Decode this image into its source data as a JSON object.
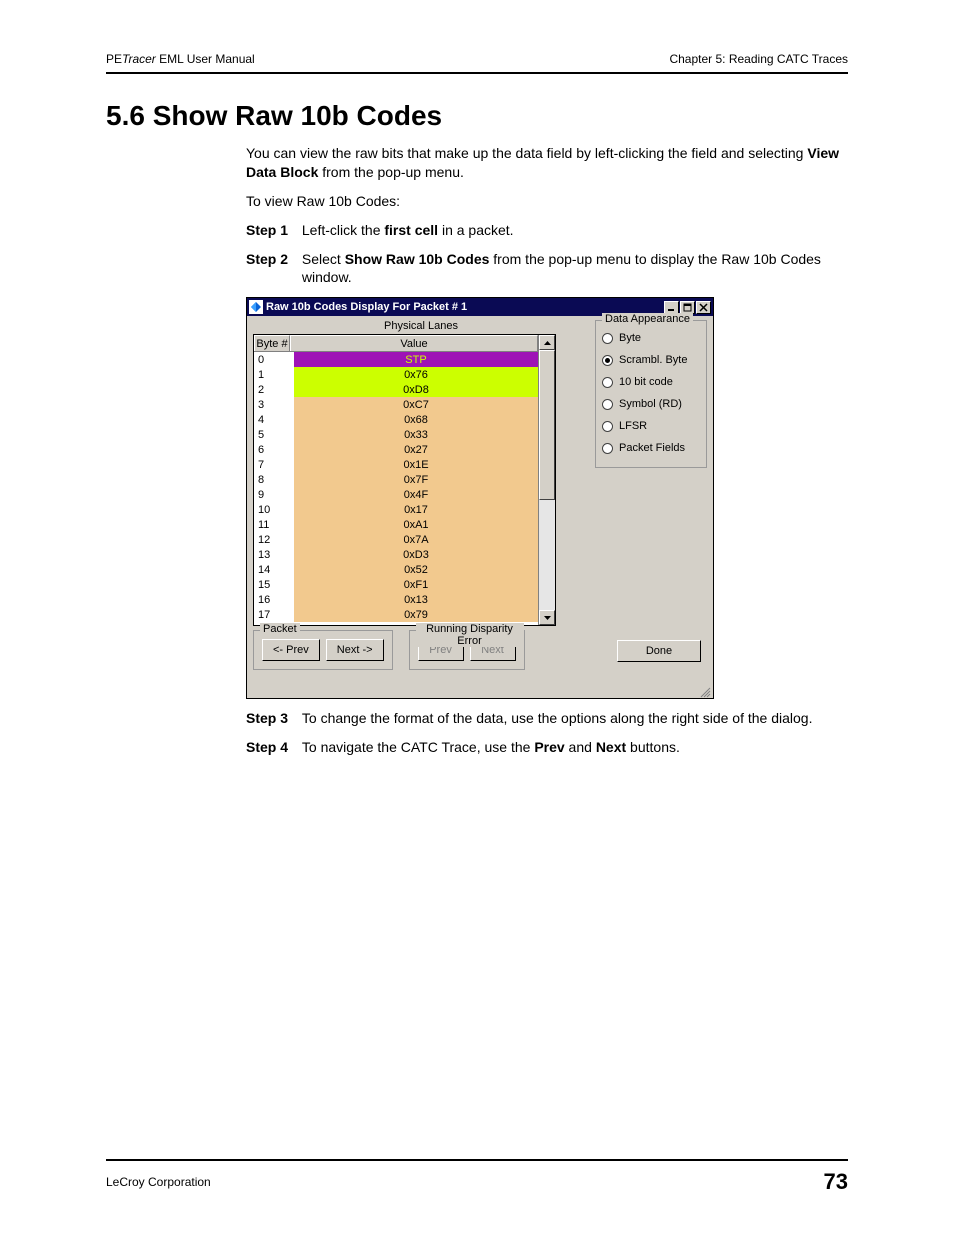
{
  "header": {
    "left_prefix": "PE",
    "left_italic": "Tracer",
    "left_suffix": " EML User Manual",
    "right": "Chapter 5: Reading CATC Traces"
  },
  "section_heading": "5.6 Show Raw 10b Codes",
  "intro": {
    "p1_prefix": "You can view the raw bits that make up the data field by left-clicking the field and selecting ",
    "p1_bold": "View Data Block",
    "p1_suffix": " from the pop-up menu.",
    "p2": "To view Raw 10b Codes:"
  },
  "steps": {
    "s1": {
      "label": "Step 1",
      "t1": "Left-click the ",
      "b1": "first cell",
      "t2": " in a packet."
    },
    "s2": {
      "label": "Step 2",
      "t1": "Select ",
      "b1": "Show Raw 10b Codes",
      "t2": " from the pop-up menu to display the Raw 10b Codes window."
    },
    "s3": {
      "label": "Step 3",
      "t1": "To change the format of the data, use the options along the right side of the dialog."
    },
    "s4": {
      "label": "Step 4",
      "t1": "To navigate the CATC Trace, use the ",
      "b1": "Prev",
      "t2": " and ",
      "b2": "Next",
      "t3": " buttons."
    }
  },
  "dialog": {
    "title": "Raw 10b Codes Display For Packet # 1",
    "lanes_label": "Physical Lanes",
    "columns": {
      "byte": "Byte #",
      "value": "Value"
    },
    "appearance": {
      "legend": "Data Appearance",
      "options": [
        "Byte",
        "Scrambl. Byte",
        "10 bit code",
        "Symbol (RD)",
        "LFSR",
        "Packet Fields"
      ],
      "selected": 1
    },
    "packet": {
      "legend": "Packet",
      "prev": "<- Prev",
      "next": "Next ->"
    },
    "rde": {
      "legend": "Running Disparity Error",
      "prev": "Prev",
      "next": "Next"
    },
    "done": "Done",
    "rows": [
      {
        "n": "0",
        "v": "STP",
        "color": "purple",
        "fg": "lime"
      },
      {
        "n": "1",
        "v": "0x76",
        "color": "lime"
      },
      {
        "n": "2",
        "v": "0xD8",
        "color": "lime"
      },
      {
        "n": "3",
        "v": "0xC7",
        "color": "tan"
      },
      {
        "n": "4",
        "v": "0x68",
        "color": "tan"
      },
      {
        "n": "5",
        "v": "0x33",
        "color": "tan"
      },
      {
        "n": "6",
        "v": "0x27",
        "color": "tan"
      },
      {
        "n": "7",
        "v": "0x1E",
        "color": "tan"
      },
      {
        "n": "8",
        "v": "0x7F",
        "color": "tan"
      },
      {
        "n": "9",
        "v": "0x4F",
        "color": "tan"
      },
      {
        "n": "10",
        "v": "0x17",
        "color": "tan"
      },
      {
        "n": "11",
        "v": "0xA1",
        "color": "tan"
      },
      {
        "n": "12",
        "v": "0x7A",
        "color": "tan"
      },
      {
        "n": "13",
        "v": "0xD3",
        "color": "tan"
      },
      {
        "n": "14",
        "v": "0x52",
        "color": "tan"
      },
      {
        "n": "15",
        "v": "0xF1",
        "color": "tan"
      },
      {
        "n": "16",
        "v": "0x13",
        "color": "tan"
      },
      {
        "n": "17",
        "v": "0x79",
        "color": "tan"
      }
    ]
  },
  "footer": {
    "left": "LeCroy Corporation",
    "page": "73"
  }
}
